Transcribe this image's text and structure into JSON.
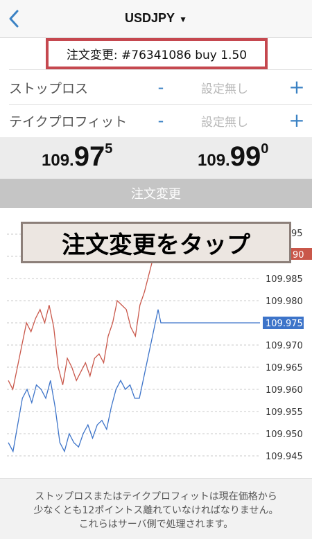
{
  "header": {
    "title": "USDJPY",
    "caret": "▼",
    "back_icon": "chevron-left-icon",
    "accent_color": "#3b82c4"
  },
  "order": {
    "label": "注文変更: #76341086 buy 1.50"
  },
  "stop_loss": {
    "label": "ストップロス",
    "minus": "-",
    "value": "設定無し",
    "plus": "+"
  },
  "take_profit": {
    "label": "テイクプロフィット",
    "minus": "-",
    "value": "設定無し",
    "plus": "+"
  },
  "prices": {
    "bid": {
      "small": "109.",
      "big": "97",
      "sup": "5"
    },
    "ask": {
      "small": "109.",
      "big": "99",
      "sup": "0"
    }
  },
  "modify_button": {
    "label": "注文変更"
  },
  "banner": {
    "text": "注文変更をタップ"
  },
  "chart_data": {
    "type": "line",
    "y_ticks": [
      "109.945",
      "109.950",
      "109.955",
      "109.960",
      "109.965",
      "109.970",
      "109.975",
      "109.980",
      "109.985"
    ],
    "partial_labels": {
      "top": "95",
      "ask_tag": "90"
    },
    "current_bid_label": "109.975",
    "ylim": [
      109.943,
      109.993
    ],
    "grid": true,
    "colors": {
      "ask": "#c9574a",
      "bid": "#3d74c9",
      "bid_tag": "#3d74c9",
      "ask_tag": "#c9574a"
    },
    "series": [
      {
        "values": [
          109.962,
          109.96,
          109.965,
          109.97,
          109.975,
          109.973,
          109.976,
          109.978,
          109.975,
          109.979,
          109.974,
          109.965,
          109.961,
          109.967,
          109.965,
          109.962,
          109.964,
          109.966,
          109.963,
          109.967,
          109.968,
          109.966,
          109.972,
          109.975,
          109.98,
          109.979,
          109.978,
          109.974,
          109.972,
          109.979,
          109.982,
          109.986,
          109.99,
          109.995
        ]
      },
      {
        "values": [
          109.948,
          109.946,
          109.952,
          109.958,
          109.96,
          109.957,
          109.961,
          109.96,
          109.958,
          109.962,
          109.956,
          109.948,
          109.946,
          109.95,
          109.948,
          109.947,
          109.95,
          109.952,
          109.949,
          109.952,
          109.953,
          109.951,
          109.956,
          109.96,
          109.962,
          109.96,
          109.961,
          109.958,
          109.958,
          109.963,
          109.968,
          109.973,
          109.978,
          109.975,
          109.975,
          109.975,
          109.975,
          109.975,
          109.975,
          109.975,
          109.975,
          109.975,
          109.975,
          109.975,
          109.975,
          109.975,
          109.975,
          109.975
        ]
      }
    ]
  },
  "footer": {
    "line1": "ストップロスまたはテイクプロフィットは現在価格から",
    "line2": "少なくとも12ポイントス離れていなければなりません。",
    "line3": "これらはサーバ側で処理されます。"
  }
}
